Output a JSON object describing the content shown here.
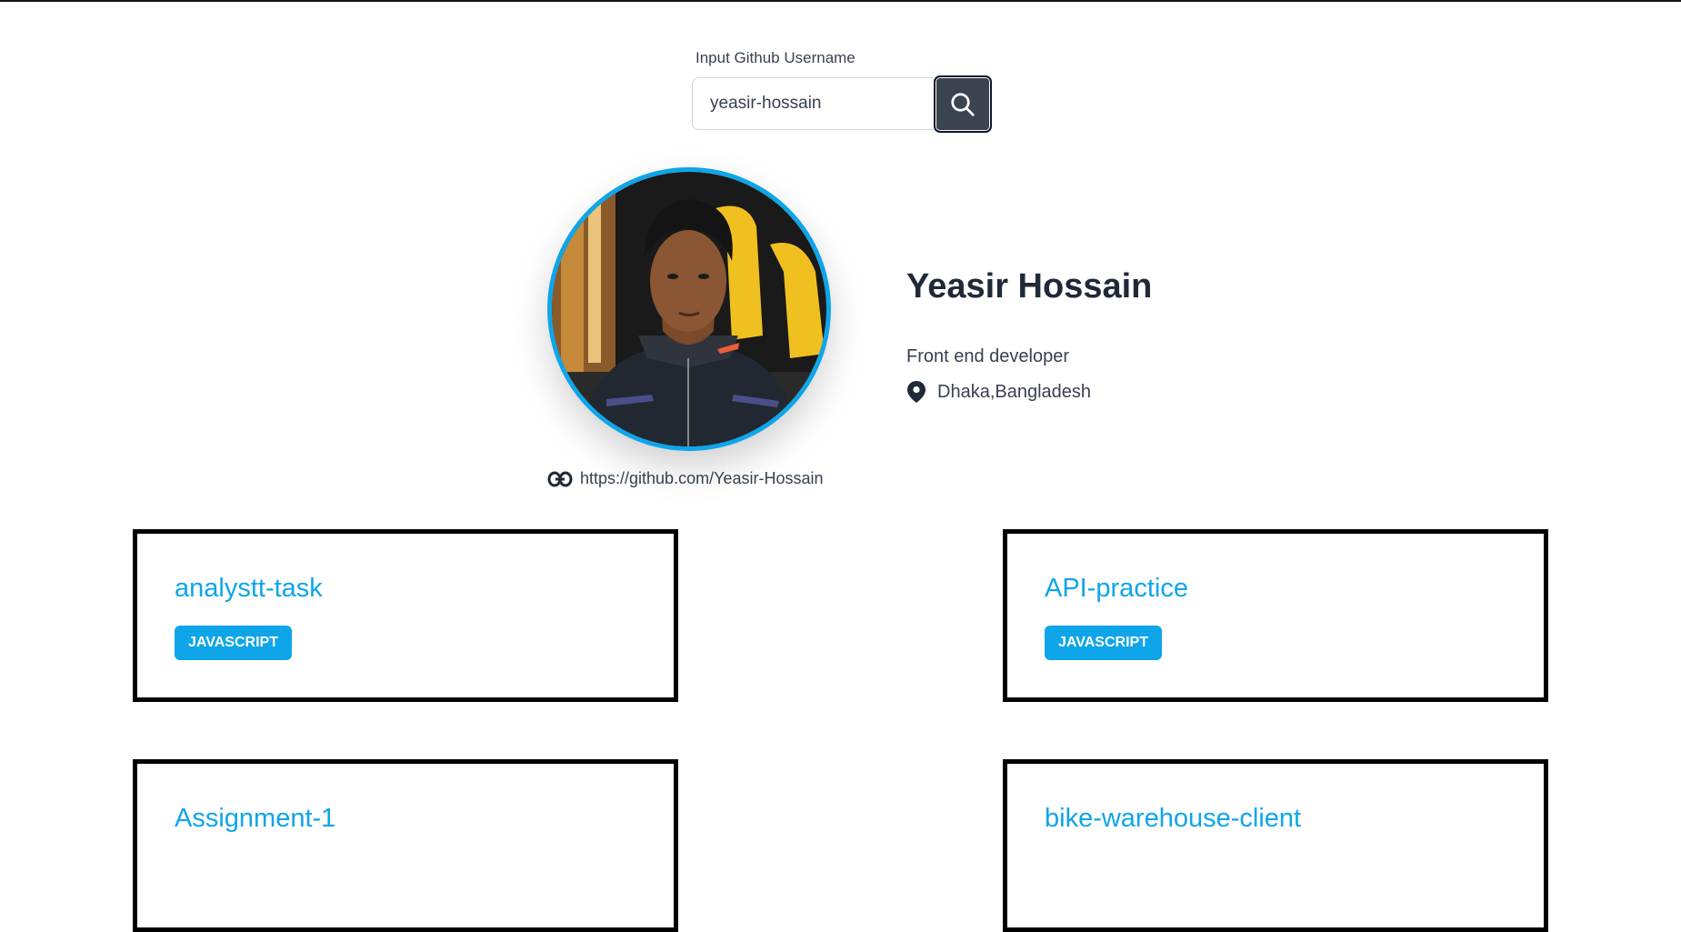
{
  "search": {
    "label": "Input Github Username",
    "value": "yeasir-hossain",
    "button_icon": "search-icon"
  },
  "profile": {
    "name": "Yeasir Hossain",
    "bio": "Front end developer",
    "location": "Dhaka,Bangladesh",
    "location_icon": "map-pin-icon",
    "url": "https://github.com/Yeasir-Hossain",
    "url_icon": "link-icon"
  },
  "repos": [
    {
      "name": "analystt-task",
      "language": "JAVASCRIPT"
    },
    {
      "name": "API-practice",
      "language": "JAVASCRIPT"
    },
    {
      "name": "Assignment-1",
      "language": ""
    },
    {
      "name": "bike-warehouse-client",
      "language": ""
    }
  ],
  "colors": {
    "accent": "#0ea5e9",
    "button": "#3b4351",
    "text": "#1f2937"
  }
}
